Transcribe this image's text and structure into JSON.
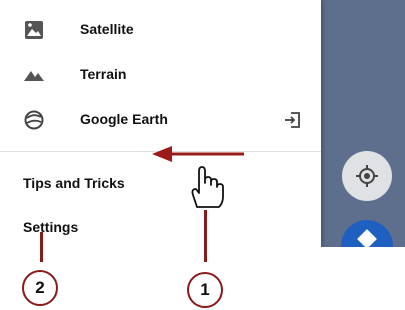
{
  "menu": {
    "items": [
      {
        "label": "Satellite",
        "icon": "satellite-icon"
      },
      {
        "label": "Terrain",
        "icon": "terrain-icon"
      },
      {
        "label": "Google Earth",
        "icon": "google-earth-icon",
        "trailing_icon": "open-external-icon"
      }
    ],
    "secondary": [
      {
        "label": "Tips and Tricks"
      },
      {
        "label": "Settings"
      }
    ]
  },
  "callouts": {
    "one": "1",
    "two": "2"
  },
  "colors": {
    "arrow": "#9b1b1b",
    "map": "#5d6f8c",
    "directions_fab": "#1e5fc0"
  }
}
